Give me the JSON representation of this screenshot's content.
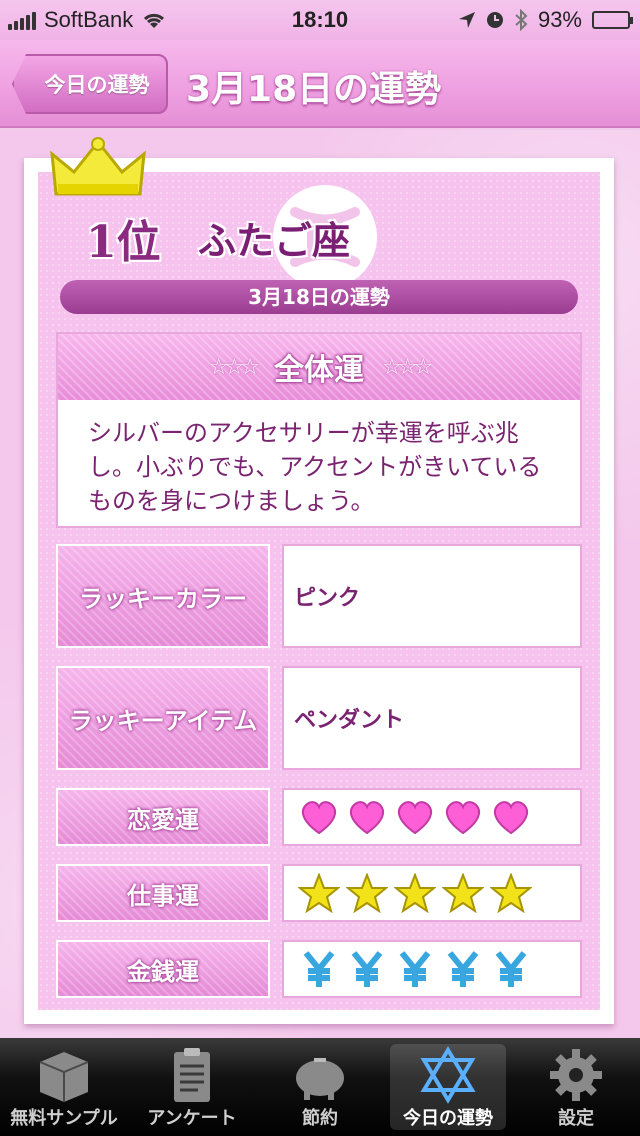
{
  "status_bar": {
    "carrier": "SoftBank",
    "time": "18:10",
    "battery": "93%",
    "battery_level": 0.93
  },
  "nav": {
    "back_label": "今日の運勢",
    "title": "3月18日の運勢"
  },
  "card": {
    "rank": "1位",
    "sign": "ふたご座",
    "date": "3月18日の運勢",
    "overall_title": "全体運",
    "overall_text": "シルバーのアクセサリーが幸運を呼ぶ兆し。小ぶりでも、アクセントがきいているものを身につけましょう。",
    "lucky_color_label": "ラッキーカラー",
    "lucky_color_value": "ピンク",
    "lucky_item_label": "ラッキーアイテム",
    "lucky_item_value": "ペンダント",
    "love_label": "恋愛運",
    "love_rating": 5,
    "work_label": "仕事運",
    "work_rating": 5,
    "money_label": "金銭運",
    "money_rating": 5
  },
  "colors": {
    "accent": "#e58ad6",
    "text": "#7a2370",
    "heart": "#ff5fd6",
    "star": "#f2e21a",
    "yen": "#3aa6e0"
  },
  "tabs": [
    {
      "label": "無料サンプル",
      "icon": "box-icon"
    },
    {
      "label": "アンケート",
      "icon": "clipboard-icon"
    },
    {
      "label": "節約",
      "icon": "piggy-bank-icon"
    },
    {
      "label": "今日の運勢",
      "icon": "hexagram-icon"
    },
    {
      "label": "設定",
      "icon": "gear-icon"
    }
  ]
}
